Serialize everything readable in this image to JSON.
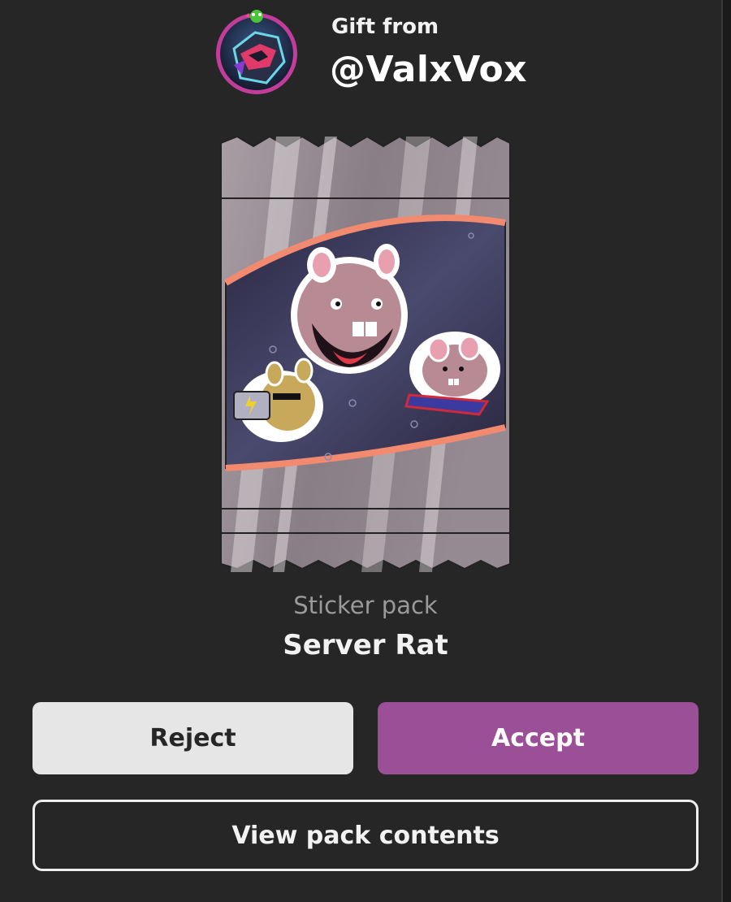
{
  "gift": {
    "label": "Gift from",
    "username": "@ValxVox"
  },
  "pack": {
    "type_label": "Sticker pack",
    "name": "Server Rat"
  },
  "actions": {
    "reject_label": "Reject",
    "accept_label": "Accept",
    "view_label": "View pack contents"
  },
  "colors": {
    "background": "#262626",
    "accept": "#9b4f96",
    "reject": "#e6e6e6"
  }
}
